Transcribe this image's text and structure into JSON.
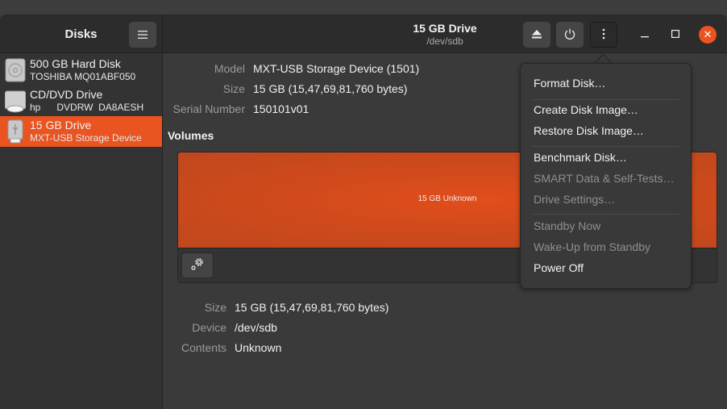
{
  "sidebar": {
    "title": "Disks",
    "menu_icon": "hamburger-icon",
    "disks": [
      {
        "name": "500 GB Hard Disk",
        "detail": "TOSHIBA MQ01ABF050",
        "icon": "hard-disk-icon",
        "selected": false
      },
      {
        "name": "CD/DVD Drive",
        "detail": "hp      DVDRW  DA8AESH",
        "icon": "optical-drive-icon",
        "selected": false
      },
      {
        "name": "15 GB Drive",
        "detail": "MXT-USB Storage Device",
        "icon": "usb-drive-icon",
        "selected": true
      }
    ]
  },
  "header": {
    "title": "15 GB Drive",
    "subtitle": "/dev/sdb",
    "buttons": [
      "eject-icon",
      "power-icon",
      "more-vertical-icon"
    ],
    "window_controls": {
      "minimize": "–",
      "maximize": "□",
      "close": "✕"
    }
  },
  "drive_info": [
    {
      "label": "Model",
      "value": "MXT-USB Storage Device (1501)"
    },
    {
      "label": "Size",
      "value": "15 GB (15,47,69,81,760 bytes)"
    },
    {
      "label": "Serial Number",
      "value": "150101v01"
    }
  ],
  "volumes": {
    "heading": "Volumes",
    "bar_label": "15 GB Unknown",
    "bar_color": "#e95420",
    "selected_volume": [
      {
        "label": "Size",
        "value": "15 GB (15,47,69,81,760 bytes)"
      },
      {
        "label": "Device",
        "value": "/dev/sdb"
      },
      {
        "label": "Contents",
        "value": "Unknown"
      }
    ]
  },
  "menu": {
    "items": [
      {
        "label": "Format Disk…",
        "enabled": true
      },
      {
        "label": "Create Disk Image…",
        "enabled": true
      },
      {
        "label": "Restore Disk Image…",
        "enabled": true
      },
      {
        "label": "Benchmark Disk…",
        "enabled": true
      },
      {
        "label": "SMART Data & Self-Tests…",
        "enabled": false
      },
      {
        "label": "Drive Settings…",
        "enabled": false
      },
      {
        "label": "Standby Now",
        "enabled": false
      },
      {
        "label": "Wake-Up from Standby",
        "enabled": false
      },
      {
        "label": "Power Off",
        "enabled": true
      }
    ]
  },
  "colors": {
    "accent": "#e95420"
  }
}
